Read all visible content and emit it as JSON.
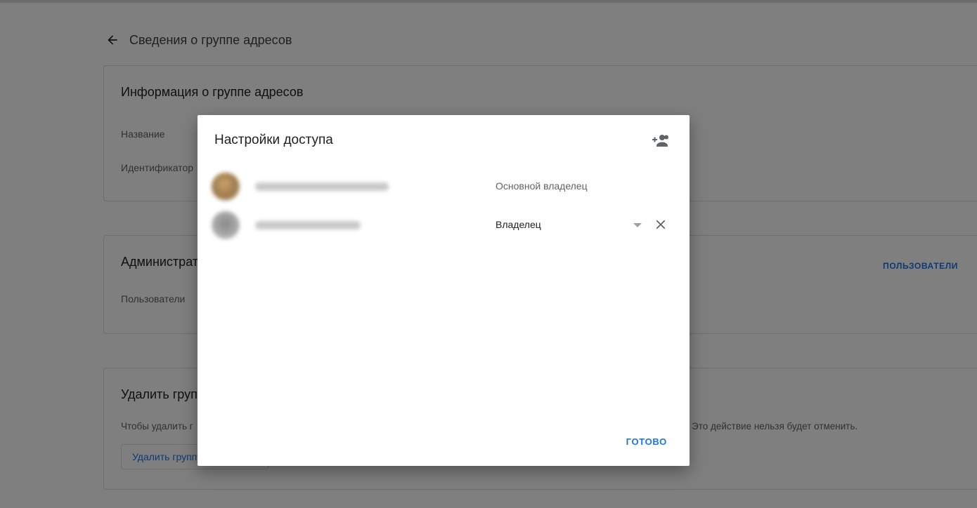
{
  "page": {
    "title": "Сведения о группе адресов"
  },
  "info_card": {
    "title": "Информация о группе адресов",
    "name_label": "Название",
    "id_label": "Идентификатор"
  },
  "admin_card": {
    "title": "Администраторы",
    "users_label": "Пользователи",
    "users_link": "ПОЛЬЗОВАТЕЛИ"
  },
  "delete_card": {
    "title": "Удалить группу адресов",
    "warning_text_start": "Чтобы удалить г",
    "warning_text_end": "Это действие нельзя будет отменить.",
    "button_label": "Удалить группу адресов"
  },
  "dialog": {
    "title": "Настройки доступа",
    "add_icon": "person-add-icon",
    "users": [
      {
        "role": "Основной владелец",
        "editable": false
      },
      {
        "role": "Владелец",
        "editable": true
      }
    ],
    "done_label": "ГОТОВО"
  },
  "colors": {
    "accent": "#1a73e8",
    "overlay": "rgba(0,0,0,0.5)"
  }
}
